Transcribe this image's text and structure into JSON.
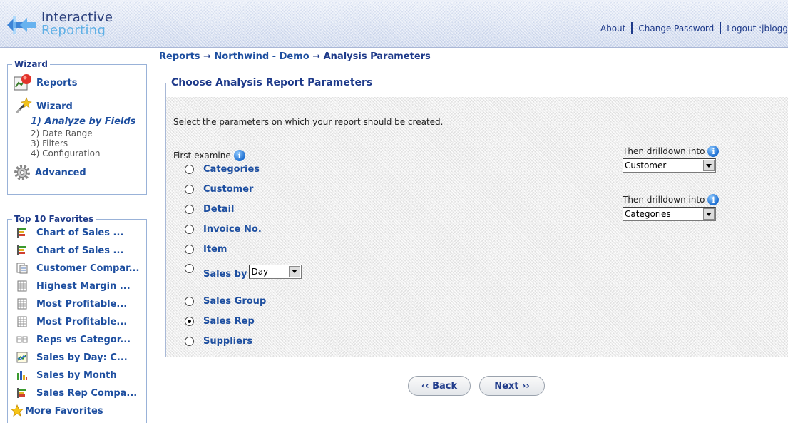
{
  "app": {
    "logo_line1": "Interactive",
    "logo_line2": "Reporting"
  },
  "toplinks": {
    "about": "About",
    "change_password": "Change Password",
    "logout": "Logout :jblogg"
  },
  "breadcrumb": {
    "item1": "Reports",
    "item2": "Northwind - Demo",
    "current": "Analysis Parameters",
    "separator": "➞"
  },
  "wizard_box": {
    "legend": "Wizard",
    "reports": "Reports",
    "wizard": "Wizard",
    "steps": [
      "1) Analyze by Fields",
      "2) Date Range",
      "3) Filters",
      "4) Configuration"
    ],
    "advanced": "Advanced"
  },
  "favorites": {
    "legend": "Top 10 Favorites",
    "items": [
      {
        "label": "Chart of Sales ...",
        "icon": "bar-chart-icon"
      },
      {
        "label": "Chart of Sales ...",
        "icon": "bar-chart-icon"
      },
      {
        "label": "Customer Compar...",
        "icon": "document-icon"
      },
      {
        "label": "Highest Margin ...",
        "icon": "table-icon"
      },
      {
        "label": "Most Profitable...",
        "icon": "table-icon"
      },
      {
        "label": "Most Profitable...",
        "icon": "table-icon"
      },
      {
        "label": "Reps vs Categor...",
        "icon": "crosstab-icon"
      },
      {
        "label": "Sales by Day: C...",
        "icon": "line-chart-icon"
      },
      {
        "label": "Sales by Month",
        "icon": "column-chart-icon"
      },
      {
        "label": "Sales Rep Compa...",
        "icon": "bar-chart-icon"
      }
    ],
    "more": "More Favorites"
  },
  "main": {
    "legend": "Choose Analysis Report Parameters",
    "intro": "Select the parameters on which your report should be created.",
    "first_examine": "First examine",
    "options": [
      "Categories",
      "Customer",
      "Detail",
      "Invoice No.",
      "Item",
      "Sales by",
      "Sales Group",
      "Sales Rep",
      "Suppliers"
    ],
    "selected_option": "Sales Rep",
    "sales_by_period": "Day",
    "drilldown1": {
      "label": "Then drilldown into",
      "value": "Customer"
    },
    "drilldown2": {
      "label": "Then drilldown into",
      "value": "Categories"
    }
  },
  "buttons": {
    "back": "‹‹ Back",
    "next": "Next ››"
  },
  "colors": {
    "link": "#1e4fa0",
    "title": "#1e3a8a",
    "border": "#99b2d8"
  }
}
